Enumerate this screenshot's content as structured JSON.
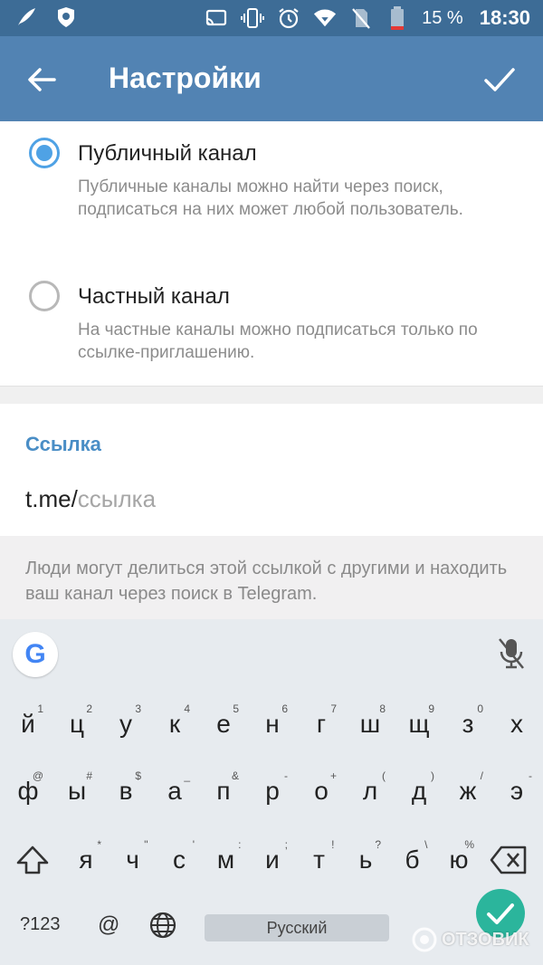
{
  "status_bar": {
    "icons_left": [
      "feather-icon",
      "lion-shield-icon"
    ],
    "icons_right": [
      "cast-icon",
      "vibrate-icon",
      "alarm-icon",
      "wifi-icon",
      "no-sim-icon",
      "battery-icon"
    ],
    "battery_percent": "15 %",
    "time": "18:30"
  },
  "app_bar": {
    "title": "Настройки",
    "back_icon": "arrow-left-icon",
    "confirm_icon": "checkmark-icon"
  },
  "channel_type": {
    "options": [
      {
        "title": "Публичный канал",
        "description": "Публичные каналы можно найти через поиск, подписаться на них может любой пользователь.",
        "selected": true
      },
      {
        "title": "Частный канал",
        "description": "На частные каналы можно подписаться только по ссылке-приглашению.",
        "selected": false
      }
    ]
  },
  "link_section": {
    "header": "Ссылка",
    "prefix": "t.me/",
    "placeholder": "ссылка",
    "hint": "Люди могут делиться этой ссылкой с другими и находить ваш канал через поиск в Telegram."
  },
  "keyboard": {
    "row1": [
      {
        "ch": "й",
        "sup": "1"
      },
      {
        "ch": "ц",
        "sup": "2"
      },
      {
        "ch": "у",
        "sup": "3"
      },
      {
        "ch": "к",
        "sup": "4"
      },
      {
        "ch": "е",
        "sup": "5"
      },
      {
        "ch": "н",
        "sup": "6"
      },
      {
        "ch": "г",
        "sup": "7"
      },
      {
        "ch": "ш",
        "sup": "8"
      },
      {
        "ch": "щ",
        "sup": "9"
      },
      {
        "ch": "з",
        "sup": "0"
      },
      {
        "ch": "х",
        "sup": ""
      }
    ],
    "row2": [
      {
        "ch": "ф",
        "sup": "@"
      },
      {
        "ch": "ы",
        "sup": "#"
      },
      {
        "ch": "в",
        "sup": "$"
      },
      {
        "ch": "а",
        "sup": "_"
      },
      {
        "ch": "п",
        "sup": "&"
      },
      {
        "ch": "р",
        "sup": "-"
      },
      {
        "ch": "о",
        "sup": "+"
      },
      {
        "ch": "л",
        "sup": "("
      },
      {
        "ch": "д",
        "sup": ")"
      },
      {
        "ch": "ж",
        "sup": "/"
      },
      {
        "ch": "э",
        "sup": "-"
      }
    ],
    "row3": [
      {
        "ch": "я",
        "sup": "*"
      },
      {
        "ch": "ч",
        "sup": "\""
      },
      {
        "ch": "с",
        "sup": "'"
      },
      {
        "ch": "м",
        "sup": ":"
      },
      {
        "ch": "и",
        "sup": ";"
      },
      {
        "ch": "т",
        "sup": "!"
      },
      {
        "ch": "ь",
        "sup": "?"
      },
      {
        "ch": "б",
        "sup": "\\"
      },
      {
        "ch": "ю",
        "sup": "%"
      }
    ],
    "numbers_key": "?123",
    "at_key": "@",
    "space_label": "Русский",
    "google_icon": "google-g-icon",
    "mic_icon": "mic-off-icon"
  },
  "watermark": "ОТЗОВИК",
  "colors": {
    "status_bar": "#3d6c96",
    "app_bar": "#5283b3",
    "accent": "#4fa2e5",
    "link_header": "#4a8ec6",
    "enter_key": "#2bb59c"
  }
}
